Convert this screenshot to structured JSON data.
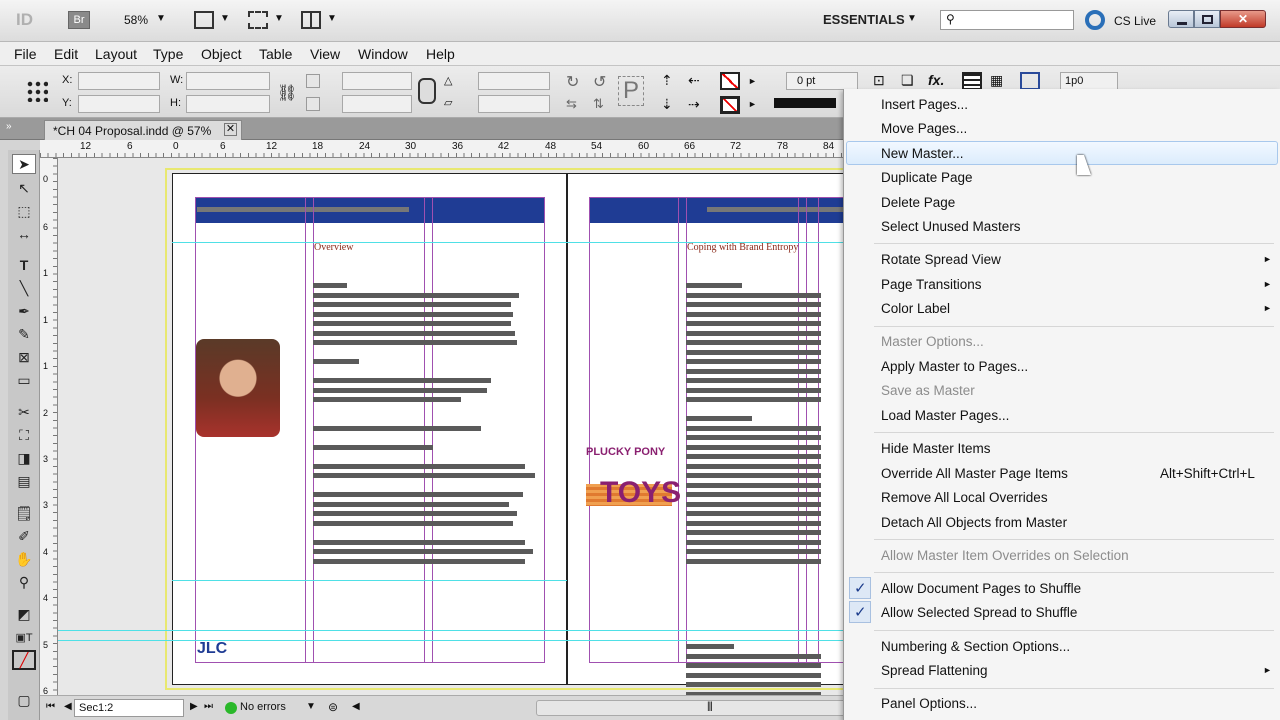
{
  "app": {
    "logo": "ID",
    "bridge": "Br",
    "zoom": "58%",
    "workspace": "ESSENTIALS",
    "cs_live": "CS Live",
    "accent": "#2a6fb8"
  },
  "menu": [
    "File",
    "Edit",
    "Layout",
    "Type",
    "Object",
    "Table",
    "View",
    "Window",
    "Help"
  ],
  "control": {
    "x_label": "X:",
    "y_label": "Y:",
    "w_label": "W:",
    "h_label": "H:",
    "stroke_weight": "0 pt",
    "value_field": "1p0",
    "fx": "fx."
  },
  "document": {
    "tab_title": "*CH 04 Proposal.indd @ 57%",
    "ruler_numbers": [
      "12",
      "6",
      "0",
      "6",
      "12",
      "18",
      "24",
      "30",
      "36",
      "42",
      "48",
      "54",
      "60",
      "66",
      "72",
      "78",
      "84"
    ],
    "vruler_numbers": [
      "0",
      "6",
      "1",
      "1",
      "1",
      "2",
      "3",
      "3",
      "4",
      "4",
      "5",
      "6"
    ],
    "page1_heading": "Overview",
    "page2_heading": "Coping with Brand Entropy",
    "logo_text": "JLC",
    "brand_line1": "PLUCKY PONY",
    "brand_line2": "TOYS"
  },
  "status": {
    "page": "Sec1:2",
    "preflight": "No errors"
  },
  "context_menu": {
    "items": [
      {
        "label": "Insert Pages...",
        "disabled": false
      },
      {
        "label": "Move Pages...",
        "disabled": false
      },
      {
        "label": "New Master...",
        "disabled": false,
        "hover": true
      },
      {
        "label": "Duplicate Page",
        "disabled": false
      },
      {
        "label": "Delete Page",
        "disabled": false
      },
      {
        "label": "Select Unused Masters",
        "disabled": false
      },
      {
        "label": "Rotate Spread View",
        "disabled": false,
        "submenu": true
      },
      {
        "label": "Page Transitions",
        "disabled": false,
        "submenu": true
      },
      {
        "label": "Color Label",
        "disabled": false,
        "submenu": true
      },
      {
        "label": "Master Options...",
        "disabled": true
      },
      {
        "label": "Apply Master to Pages...",
        "disabled": false
      },
      {
        "label": "Save as Master",
        "disabled": true
      },
      {
        "label": "Load Master Pages...",
        "disabled": false
      },
      {
        "label": "Hide Master Items",
        "disabled": false
      },
      {
        "label": "Override All Master Page Items",
        "disabled": false,
        "shortcut": "Alt+Shift+Ctrl+L"
      },
      {
        "label": "Remove All Local Overrides",
        "disabled": false
      },
      {
        "label": "Detach All Objects from Master",
        "disabled": false
      },
      {
        "label": "Allow Master Item Overrides on Selection",
        "disabled": true
      },
      {
        "label": "Allow Document Pages to Shuffle",
        "disabled": false,
        "checked": true
      },
      {
        "label": "Allow Selected Spread to Shuffle",
        "disabled": false,
        "checked": true
      },
      {
        "label": "Numbering & Section Options...",
        "disabled": false
      },
      {
        "label": "Spread Flattening",
        "disabled": false,
        "submenu": true
      },
      {
        "label": "Panel Options...",
        "disabled": false
      }
    ],
    "check_glyph": "✓",
    "submenu_glyph": "►"
  }
}
